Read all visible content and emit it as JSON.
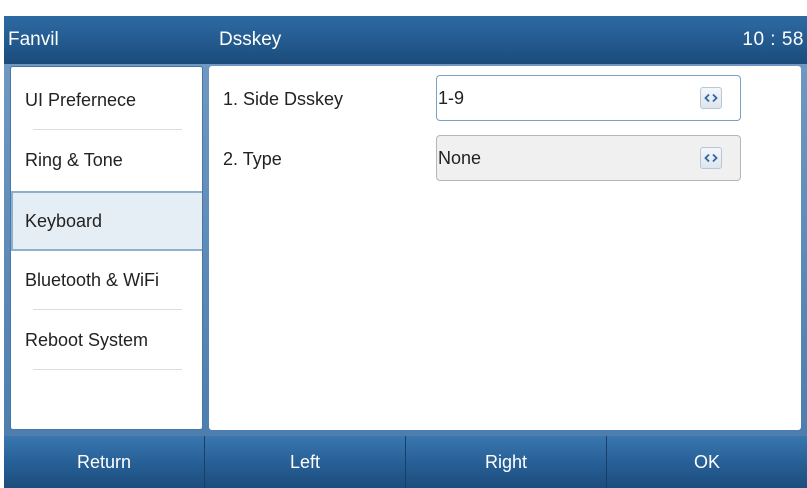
{
  "header": {
    "brand": "Fanvil",
    "title": "Dsskey",
    "time": "10 : 58"
  },
  "sidebar": {
    "items": [
      {
        "label": "UI Prefernece",
        "selected": false
      },
      {
        "label": "Ring & Tone",
        "selected": false
      },
      {
        "label": "Keyboard",
        "selected": true
      },
      {
        "label": "Bluetooth & WiFi",
        "selected": false
      },
      {
        "label": "Reboot System",
        "selected": false
      }
    ]
  },
  "settings": [
    {
      "label": "1.  Side Dsskey",
      "value": "1-9",
      "focused": true
    },
    {
      "label": "2.  Type",
      "value": "None",
      "focused": false
    }
  ],
  "softkeys": [
    "Return",
    "Left",
    "Right",
    "OK"
  ],
  "icons": {
    "value_toggle": "left-right-arrows-icon"
  },
  "colors": {
    "header": "#235a8e",
    "softkey": "#265e94",
    "frame": "#5f8dbb",
    "selected_item": "#e6eef5"
  }
}
